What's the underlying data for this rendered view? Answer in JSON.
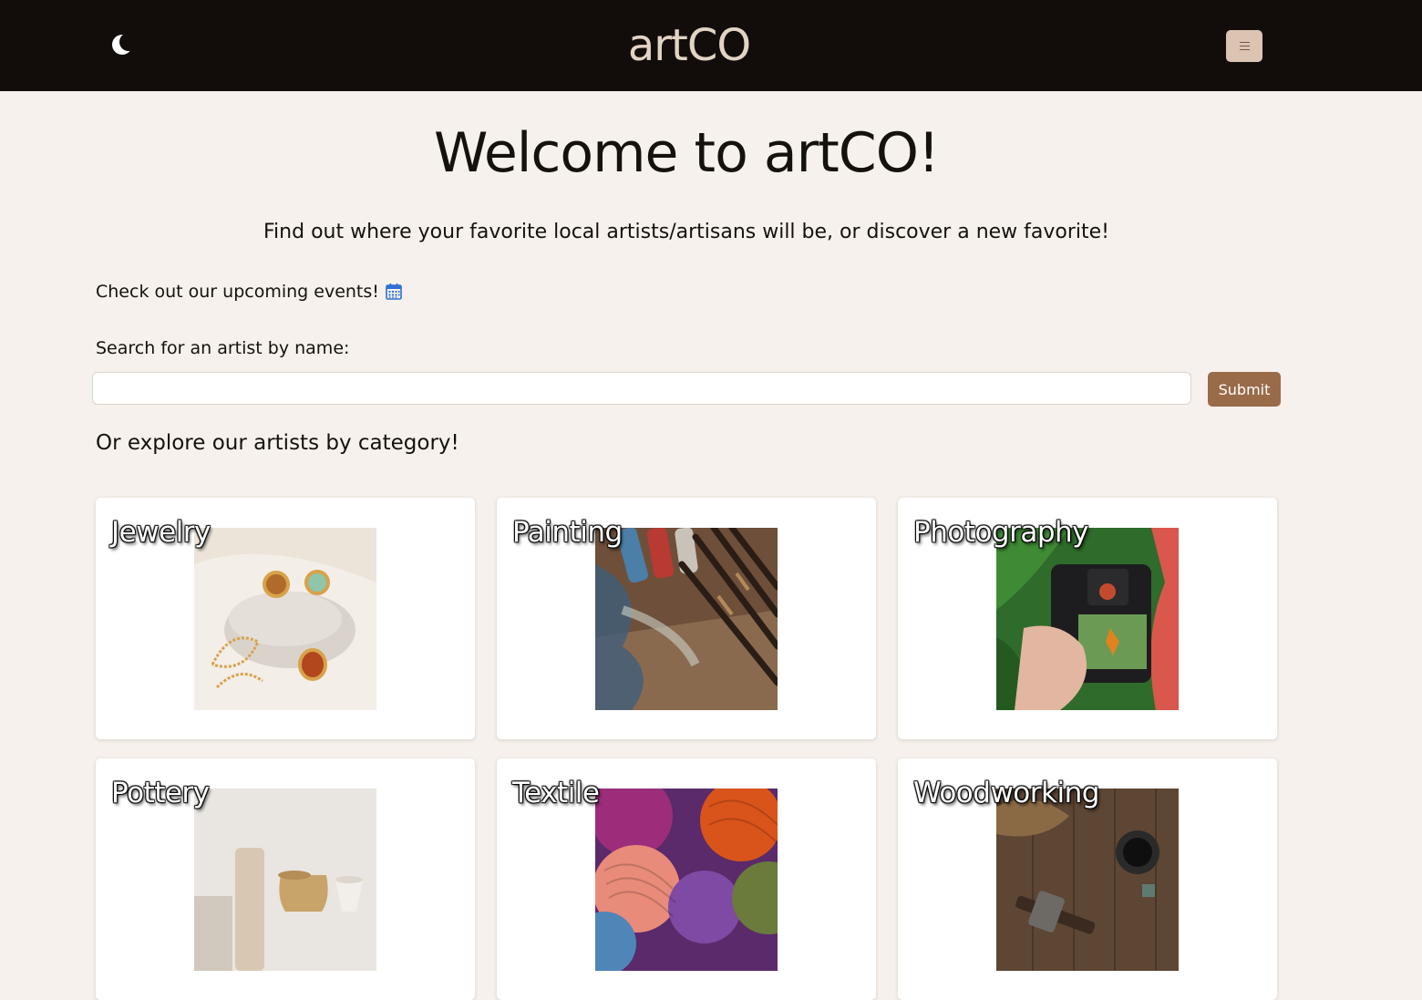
{
  "header": {
    "brand": "artCO",
    "theme_icon": "moon-icon",
    "menu_icon": "hamburger-menu-icon"
  },
  "main": {
    "headline": "Welcome to artCO!",
    "tagline": "Find out where your favorite local artists/artisans will be, or discover a new favorite!",
    "events_text": "Check out our upcoming events!",
    "events_icon": "calendar-icon",
    "search_label": "Search for an artist by name:",
    "search_value": "",
    "submit_label": "Submit",
    "explore_heading": "Or explore our artists by category!"
  },
  "categories": [
    {
      "label": "Jewelry",
      "image": "jewelry-photo"
    },
    {
      "label": "Painting",
      "image": "painting-photo"
    },
    {
      "label": "Photography",
      "image": "photography-photo"
    },
    {
      "label": "Pottery",
      "image": "pottery-photo"
    },
    {
      "label": "Textile",
      "image": "textile-photo"
    },
    {
      "label": "Woodworking",
      "image": "woodworking-photo"
    }
  ],
  "colors": {
    "header_bg": "#120d0a",
    "page_bg": "#f6f1ed",
    "brand_text": "#e3d3c4",
    "menu_button": "#dcc4b2",
    "submit_button": "#9a6b48",
    "calendar_icon": "#2f6fd6"
  }
}
